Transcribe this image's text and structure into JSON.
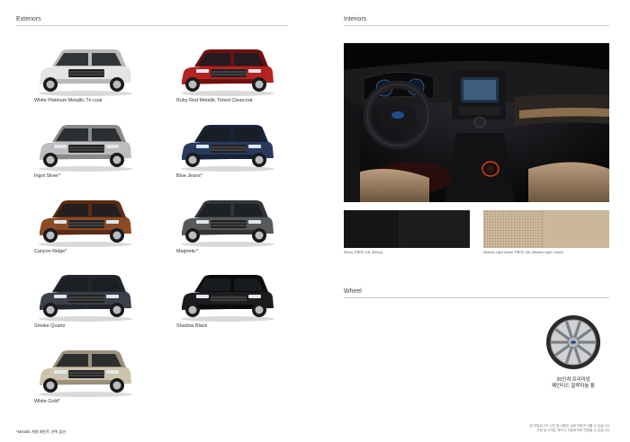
{
  "exteriors": {
    "title": "Exteriors",
    "colors": [
      {
        "name": "White Platinum Metallic Tri-coat",
        "body": "#e4e4e2",
        "shade": "#b9b9b7"
      },
      {
        "name": "Ruby Red Metallic Tinted Clearcoat",
        "body": "#b3231f",
        "shade": "#6e1210"
      },
      {
        "name": "Ingot Silver*",
        "body": "#bdbdbd",
        "shade": "#8a8a8a"
      },
      {
        "name": "Blue Jeans*",
        "body": "#283b5e",
        "shade": "#162338"
      },
      {
        "name": "Canyon Ridge*",
        "body": "#8b4a25",
        "shade": "#5a2c13"
      },
      {
        "name": "Magnetic*",
        "body": "#58595b",
        "shade": "#333436"
      },
      {
        "name": "Smoke Quartz",
        "body": "#3b3f4a",
        "shade": "#22252c"
      },
      {
        "name": "Shadow Black",
        "body": "#1c1c1e",
        "shade": "#0b0b0c"
      },
      {
        "name": "White Gold*",
        "body": "#cdc3ad",
        "shade": "#9b917c"
      }
    ],
    "footnote": "*Metallic 계열 페인트 선택 옵션"
  },
  "interiors": {
    "title": "Interiors",
    "swatches": [
      {
        "name": "Ebony 가죽/천 시트 (Ebony)",
        "color": "#1c1c1c"
      },
      {
        "name": "Medium Light Camel 가죽/천 시트 (Medium Light Camel)",
        "color": "#cbb79a"
      }
    ]
  },
  "wheel": {
    "title": "Wheel",
    "caption_line1": "20인치 프리미엄",
    "caption_line2": "페인티드 알루미늄 휠"
  },
  "disclaimer": {
    "line1": "본 카탈로그의 사진 및 내용은 실제 차량과 다를 수 있습니다.",
    "line2": "사양 및 가격은 제조사 사정에 따라 변경될 수 있습니다."
  }
}
